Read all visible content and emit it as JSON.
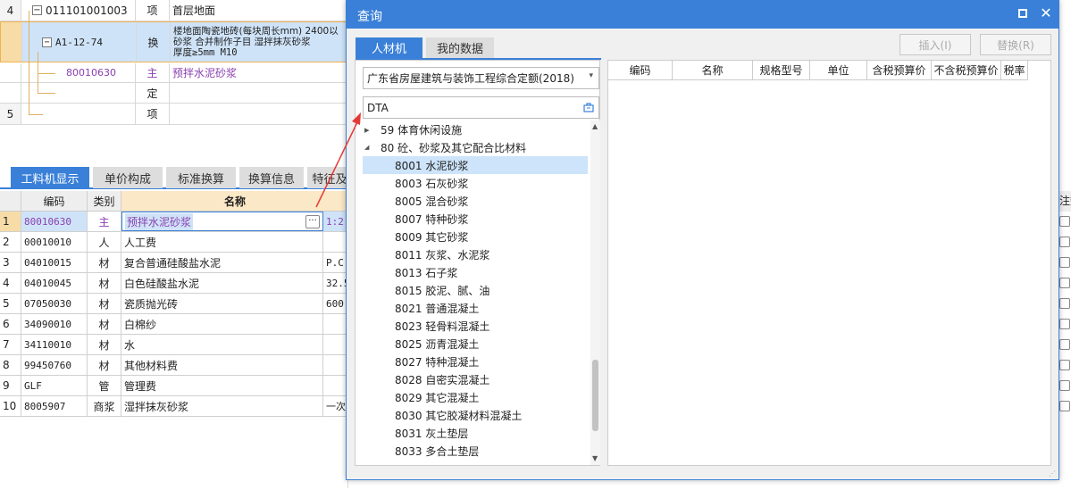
{
  "top_grid": {
    "rows": [
      {
        "num": "4",
        "code": "011101001003",
        "type": "项",
        "name": "首层地面"
      },
      {
        "num": "",
        "code": "A1-12-74",
        "type": "换",
        "name_lines": [
          "楼地面陶瓷地砖(每块周长mm) 2400以",
          "砂浆  合并制作子目 湿拌抹灰砂浆",
          "厚度≥5mm M10"
        ]
      },
      {
        "num": "",
        "code": "80010630",
        "type": "主",
        "name": "预拌水泥砂浆"
      },
      {
        "num": "",
        "code": "",
        "type": "定",
        "name": ""
      },
      {
        "num": "5",
        "code": "",
        "type": "项",
        "name": ""
      }
    ]
  },
  "bottom_tabs": [
    "工料机显示",
    "单价构成",
    "标准换算",
    "换算信息",
    "特征及"
  ],
  "material_table": {
    "headers": [
      "编码",
      "类别",
      "名称"
    ],
    "right_header_partial": "注数",
    "rows": [
      {
        "num": "1",
        "code": "80010630",
        "cat": "主",
        "name": "预拌水泥砂浆",
        "spec": "1:2"
      },
      {
        "num": "2",
        "code": "00010010",
        "cat": "人",
        "name": "人工费",
        "spec": ""
      },
      {
        "num": "3",
        "code": "04010015",
        "cat": "材",
        "name": "复合普通硅酸盐水泥",
        "spec": "P.C"
      },
      {
        "num": "4",
        "code": "04010045",
        "cat": "材",
        "name": "白色硅酸盐水泥",
        "spec": "32.5"
      },
      {
        "num": "5",
        "code": "07050030",
        "cat": "材",
        "name": "瓷质抛光砖",
        "spec": "600"
      },
      {
        "num": "6",
        "code": "34090010",
        "cat": "材",
        "name": "白棉纱",
        "spec": ""
      },
      {
        "num": "7",
        "code": "34110010",
        "cat": "材",
        "name": "水",
        "spec": ""
      },
      {
        "num": "8",
        "code": "99450760",
        "cat": "材",
        "name": "其他材料费",
        "spec": ""
      },
      {
        "num": "9",
        "code": "GLF",
        "cat": "管",
        "name": "管理费",
        "spec": ""
      },
      {
        "num": "10",
        "code": "8005907",
        "cat": "商浆",
        "name": "湿拌抹灰砂浆",
        "spec": "一次"
      }
    ]
  },
  "dialog": {
    "title": "查询",
    "tabs": [
      "人材机",
      "我的数据"
    ],
    "insert_label": "插入(I)",
    "replace_label": "替换(R)",
    "quota_select": "广东省房屋建筑与装饰工程综合定额(2018)",
    "search_value": "DTA",
    "tree": [
      {
        "label": "59 体育休闲设施",
        "level": 0,
        "expanded": false,
        "selected": false
      },
      {
        "label": "80 砼、砂浆及其它配合比材料",
        "level": 0,
        "expanded": true,
        "selected": false
      },
      {
        "label": "8001 水泥砂浆",
        "level": 1,
        "selected": true
      },
      {
        "label": "8003 石灰砂浆",
        "level": 1,
        "selected": false
      },
      {
        "label": "8005 混合砂浆",
        "level": 1,
        "selected": false
      },
      {
        "label": "8007 特种砂浆",
        "level": 1,
        "selected": false
      },
      {
        "label": "8009 其它砂浆",
        "level": 1,
        "selected": false
      },
      {
        "label": "8011 灰浆、水泥浆",
        "level": 1,
        "selected": false
      },
      {
        "label": "8013 石子浆",
        "level": 1,
        "selected": false
      },
      {
        "label": "8015 胶泥、腻、油",
        "level": 1,
        "selected": false
      },
      {
        "label": "8021 普通混凝土",
        "level": 1,
        "selected": false
      },
      {
        "label": "8023 轻骨料混凝土",
        "level": 1,
        "selected": false
      },
      {
        "label": "8025 沥青混凝土",
        "level": 1,
        "selected": false
      },
      {
        "label": "8027 特种混凝土",
        "level": 1,
        "selected": false
      },
      {
        "label": "8028 自密实混凝土",
        "level": 1,
        "selected": false
      },
      {
        "label": "8029 其它混凝土",
        "level": 1,
        "selected": false
      },
      {
        "label": "8030 其它胶凝材料混凝土",
        "level": 1,
        "selected": false
      },
      {
        "label": "8031 灰土垫层",
        "level": 1,
        "selected": false
      },
      {
        "label": "8033 多合土垫层",
        "level": 1,
        "selected": false
      }
    ],
    "result_headers": [
      "编码",
      "名称",
      "规格型号",
      "单位",
      "含税预算价",
      "不含税预算价",
      "税率"
    ]
  },
  "colors": {
    "accent": "#3a80d8",
    "purple": "#8a3fb0",
    "selected_row": "#cfe3f8",
    "tree_selected": "#cde4fa",
    "arrow": "#e53935"
  },
  "icons": [
    "minus-box-icon",
    "close-icon",
    "maximize-icon",
    "dropdown-arrow-icon",
    "search-clear-icon",
    "tree-expand-icon",
    "tree-collapse-icon",
    "scroll-up-icon",
    "scroll-down-icon",
    "ellipsis-button-icon",
    "resize-grip-icon"
  ]
}
